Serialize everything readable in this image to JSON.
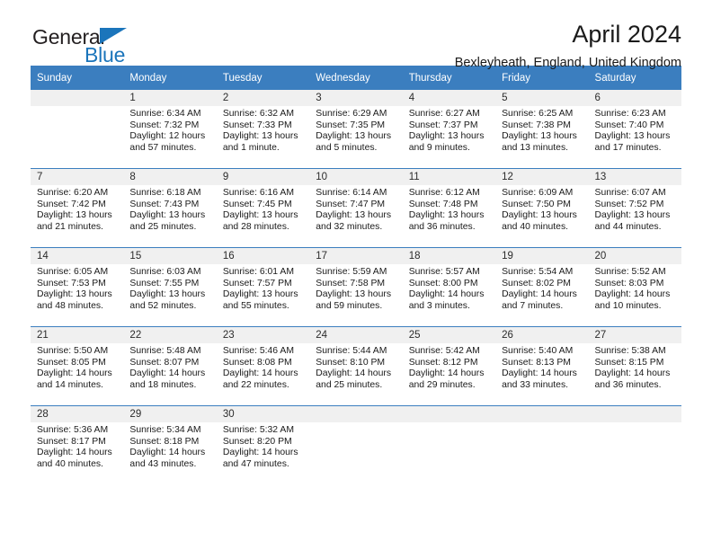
{
  "brand": {
    "word_one": "General",
    "word_two": "Blue",
    "triangle_color": "#1b75bb",
    "text_color": "#231f20"
  },
  "header": {
    "title": "April 2024",
    "subtitle": "Bexleyheath, England, United Kingdom",
    "header_bg": "#3b7ebf",
    "daynum_bg": "#f0f0f0"
  },
  "weekdays": [
    "Sunday",
    "Monday",
    "Tuesday",
    "Wednesday",
    "Thursday",
    "Friday",
    "Saturday"
  ],
  "labels": {
    "sunrise_prefix": "Sunrise:",
    "sunset_prefix": "Sunset:",
    "daylight_prefix": "Daylight:"
  },
  "weeks": [
    [
      {
        "day": "",
        "empty": true
      },
      {
        "day": "1",
        "sunrise": "Sunrise: 6:34 AM",
        "sunset": "Sunset: 7:32 PM",
        "daylight_line1": "Daylight: 12 hours",
        "daylight_line2": "and 57 minutes."
      },
      {
        "day": "2",
        "sunrise": "Sunrise: 6:32 AM",
        "sunset": "Sunset: 7:33 PM",
        "daylight_line1": "Daylight: 13 hours",
        "daylight_line2": "and 1 minute."
      },
      {
        "day": "3",
        "sunrise": "Sunrise: 6:29 AM",
        "sunset": "Sunset: 7:35 PM",
        "daylight_line1": "Daylight: 13 hours",
        "daylight_line2": "and 5 minutes."
      },
      {
        "day": "4",
        "sunrise": "Sunrise: 6:27 AM",
        "sunset": "Sunset: 7:37 PM",
        "daylight_line1": "Daylight: 13 hours",
        "daylight_line2": "and 9 minutes."
      },
      {
        "day": "5",
        "sunrise": "Sunrise: 6:25 AM",
        "sunset": "Sunset: 7:38 PM",
        "daylight_line1": "Daylight: 13 hours",
        "daylight_line2": "and 13 minutes."
      },
      {
        "day": "6",
        "sunrise": "Sunrise: 6:23 AM",
        "sunset": "Sunset: 7:40 PM",
        "daylight_line1": "Daylight: 13 hours",
        "daylight_line2": "and 17 minutes."
      }
    ],
    [
      {
        "day": "7",
        "sunrise": "Sunrise: 6:20 AM",
        "sunset": "Sunset: 7:42 PM",
        "daylight_line1": "Daylight: 13 hours",
        "daylight_line2": "and 21 minutes."
      },
      {
        "day": "8",
        "sunrise": "Sunrise: 6:18 AM",
        "sunset": "Sunset: 7:43 PM",
        "daylight_line1": "Daylight: 13 hours",
        "daylight_line2": "and 25 minutes."
      },
      {
        "day": "9",
        "sunrise": "Sunrise: 6:16 AM",
        "sunset": "Sunset: 7:45 PM",
        "daylight_line1": "Daylight: 13 hours",
        "daylight_line2": "and 28 minutes."
      },
      {
        "day": "10",
        "sunrise": "Sunrise: 6:14 AM",
        "sunset": "Sunset: 7:47 PM",
        "daylight_line1": "Daylight: 13 hours",
        "daylight_line2": "and 32 minutes."
      },
      {
        "day": "11",
        "sunrise": "Sunrise: 6:12 AM",
        "sunset": "Sunset: 7:48 PM",
        "daylight_line1": "Daylight: 13 hours",
        "daylight_line2": "and 36 minutes."
      },
      {
        "day": "12",
        "sunrise": "Sunrise: 6:09 AM",
        "sunset": "Sunset: 7:50 PM",
        "daylight_line1": "Daylight: 13 hours",
        "daylight_line2": "and 40 minutes."
      },
      {
        "day": "13",
        "sunrise": "Sunrise: 6:07 AM",
        "sunset": "Sunset: 7:52 PM",
        "daylight_line1": "Daylight: 13 hours",
        "daylight_line2": "and 44 minutes."
      }
    ],
    [
      {
        "day": "14",
        "sunrise": "Sunrise: 6:05 AM",
        "sunset": "Sunset: 7:53 PM",
        "daylight_line1": "Daylight: 13 hours",
        "daylight_line2": "and 48 minutes."
      },
      {
        "day": "15",
        "sunrise": "Sunrise: 6:03 AM",
        "sunset": "Sunset: 7:55 PM",
        "daylight_line1": "Daylight: 13 hours",
        "daylight_line2": "and 52 minutes."
      },
      {
        "day": "16",
        "sunrise": "Sunrise: 6:01 AM",
        "sunset": "Sunset: 7:57 PM",
        "daylight_line1": "Daylight: 13 hours",
        "daylight_line2": "and 55 minutes."
      },
      {
        "day": "17",
        "sunrise": "Sunrise: 5:59 AM",
        "sunset": "Sunset: 7:58 PM",
        "daylight_line1": "Daylight: 13 hours",
        "daylight_line2": "and 59 minutes."
      },
      {
        "day": "18",
        "sunrise": "Sunrise: 5:57 AM",
        "sunset": "Sunset: 8:00 PM",
        "daylight_line1": "Daylight: 14 hours",
        "daylight_line2": "and 3 minutes."
      },
      {
        "day": "19",
        "sunrise": "Sunrise: 5:54 AM",
        "sunset": "Sunset: 8:02 PM",
        "daylight_line1": "Daylight: 14 hours",
        "daylight_line2": "and 7 minutes."
      },
      {
        "day": "20",
        "sunrise": "Sunrise: 5:52 AM",
        "sunset": "Sunset: 8:03 PM",
        "daylight_line1": "Daylight: 14 hours",
        "daylight_line2": "and 10 minutes."
      }
    ],
    [
      {
        "day": "21",
        "sunrise": "Sunrise: 5:50 AM",
        "sunset": "Sunset: 8:05 PM",
        "daylight_line1": "Daylight: 14 hours",
        "daylight_line2": "and 14 minutes."
      },
      {
        "day": "22",
        "sunrise": "Sunrise: 5:48 AM",
        "sunset": "Sunset: 8:07 PM",
        "daylight_line1": "Daylight: 14 hours",
        "daylight_line2": "and 18 minutes."
      },
      {
        "day": "23",
        "sunrise": "Sunrise: 5:46 AM",
        "sunset": "Sunset: 8:08 PM",
        "daylight_line1": "Daylight: 14 hours",
        "daylight_line2": "and 22 minutes."
      },
      {
        "day": "24",
        "sunrise": "Sunrise: 5:44 AM",
        "sunset": "Sunset: 8:10 PM",
        "daylight_line1": "Daylight: 14 hours",
        "daylight_line2": "and 25 minutes."
      },
      {
        "day": "25",
        "sunrise": "Sunrise: 5:42 AM",
        "sunset": "Sunset: 8:12 PM",
        "daylight_line1": "Daylight: 14 hours",
        "daylight_line2": "and 29 minutes."
      },
      {
        "day": "26",
        "sunrise": "Sunrise: 5:40 AM",
        "sunset": "Sunset: 8:13 PM",
        "daylight_line1": "Daylight: 14 hours",
        "daylight_line2": "and 33 minutes."
      },
      {
        "day": "27",
        "sunrise": "Sunrise: 5:38 AM",
        "sunset": "Sunset: 8:15 PM",
        "daylight_line1": "Daylight: 14 hours",
        "daylight_line2": "and 36 minutes."
      }
    ],
    [
      {
        "day": "28",
        "sunrise": "Sunrise: 5:36 AM",
        "sunset": "Sunset: 8:17 PM",
        "daylight_line1": "Daylight: 14 hours",
        "daylight_line2": "and 40 minutes."
      },
      {
        "day": "29",
        "sunrise": "Sunrise: 5:34 AM",
        "sunset": "Sunset: 8:18 PM",
        "daylight_line1": "Daylight: 14 hours",
        "daylight_line2": "and 43 minutes."
      },
      {
        "day": "30",
        "sunrise": "Sunrise: 5:32 AM",
        "sunset": "Sunset: 8:20 PM",
        "daylight_line1": "Daylight: 14 hours",
        "daylight_line2": "and 47 minutes."
      },
      {
        "day": "",
        "empty": true
      },
      {
        "day": "",
        "empty": true
      },
      {
        "day": "",
        "empty": true
      },
      {
        "day": "",
        "empty": true
      }
    ]
  ]
}
